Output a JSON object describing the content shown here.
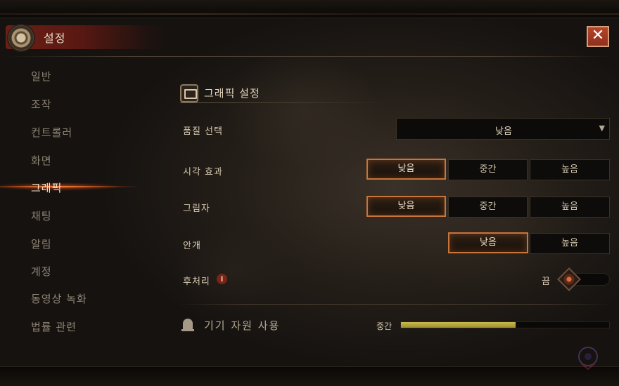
{
  "window": {
    "title": "설정"
  },
  "sidebar": {
    "items": [
      {
        "label": "일반"
      },
      {
        "label": "조작"
      },
      {
        "label": "컨트롤러"
      },
      {
        "label": "화면"
      },
      {
        "label": "그래픽",
        "active": true
      },
      {
        "label": "채팅"
      },
      {
        "label": "알림"
      },
      {
        "label": "계정"
      },
      {
        "label": "동영상 녹화"
      },
      {
        "label": "법률 관련"
      }
    ]
  },
  "section": {
    "title": "그래픽 설정",
    "icon": "image-icon"
  },
  "settings": {
    "quality": {
      "label": "품질 선택",
      "value": "낮음",
      "arrow": "▼"
    },
    "visual_effects": {
      "label": "시각 효과",
      "options": [
        "낮음",
        "중간",
        "높음"
      ],
      "selected": "낮음"
    },
    "shadows": {
      "label": "그림자",
      "options": [
        "낮음",
        "중간",
        "높음"
      ],
      "selected": "낮음"
    },
    "fog": {
      "label": "안개",
      "options": [
        "낮음",
        "높음"
      ],
      "selected": "낮음"
    },
    "post_processing": {
      "label": "후처리",
      "info_icon": "i",
      "toggle_label": "끔",
      "enabled": false
    }
  },
  "device_resources": {
    "label": "기기 자원 사용",
    "level_text": "중간",
    "usage_fraction": 0.55
  },
  "colors": {
    "accent": "#c9743a",
    "close_button": "#b5452b",
    "usage_bar": "#c9b94e",
    "title_banner": "#6b1f16"
  },
  "close_label": "✕"
}
